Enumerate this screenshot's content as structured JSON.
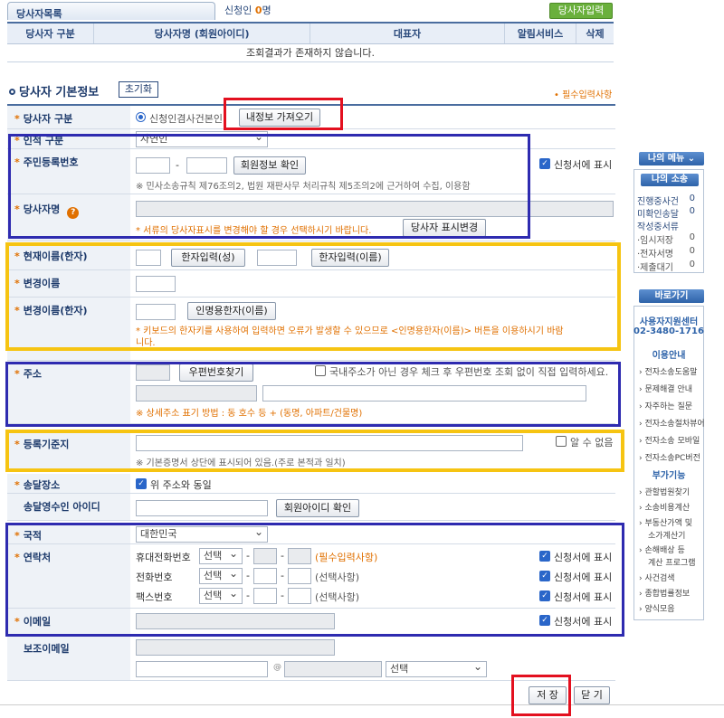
{
  "list": {
    "tab": "당사자목록",
    "count_label": "신청인",
    "count_value": "0",
    "count_unit": "명",
    "input_button": "당사자입력",
    "columns": [
      "당사자 구분",
      "당사자명 (회원아이디)",
      "대표자",
      "알림서비스",
      "삭제"
    ],
    "empty_text": "조회결과가 존재하지 않습니다."
  },
  "section": {
    "title": "당사자 기본정보",
    "reset": "초기화",
    "required_note": "• 필수입력사항"
  },
  "form": {
    "party_type": {
      "label": "당사자 구분",
      "option": "신청인겸사건본인",
      "button": "내정보 가져오기"
    },
    "person_type": {
      "label": "인적 구분",
      "value": "자연인"
    },
    "rrn": {
      "label": "주민등록번호",
      "button": "회원정보 확인",
      "note": "※ 민사소송규칙 제76조의2, 법원 재판사무 처리규칙 제5조의2에 근거하여 수집, 이용함",
      "checkbox": "신청서에 표시"
    },
    "name": {
      "label": "당사자명",
      "warning": "* 서류의 당사자표시를 변경해야 할 경우 선택하시기 바랍니다.",
      "button": "당사자 표시변경"
    },
    "hanja_current": {
      "label": "현재이름(한자)",
      "btn_surname": "한자입력(성)",
      "btn_given": "한자입력(이름)"
    },
    "changed_name": {
      "label": "변경이름"
    },
    "changed_hanja": {
      "label": "변경이름(한자)",
      "button": "인명용한자(이름)",
      "warning_1": "* 키보드의 한자키를 사용하여 입력하면 오류가 발생할 수 있으므로 <인명용한자(이름)> 버튼을 이용하시기 바람",
      "warning_2": "니다."
    },
    "address": {
      "label": "주소",
      "button": "우편번호찾기",
      "checkbox": "국내주소가 아닌 경우 체크 후 우편번호 조회 없이 직접 입력하세요.",
      "note": "※ 상세주소 표기 방법 : 동 호수 등 + (동명, 아파트/건물명)"
    },
    "reg_base": {
      "label": "등록기준지",
      "checkbox": "알 수 없음",
      "note": "※ 기본증명서 상단에 표시되어 있음.(주로 본적과 일치)"
    },
    "delivery": {
      "label": "송달장소",
      "checkbox": "위 주소와 동일"
    },
    "recipient_id": {
      "label": "송달영수인 아이디",
      "button": "회원아이디 확인"
    },
    "nationality": {
      "label": "국적",
      "value": "대한민국"
    },
    "contact": {
      "label": "연락처",
      "rows": [
        {
          "name": "휴대전화번호",
          "select": "선택",
          "hint": "(필수입력사항)",
          "checkbox": "신청서에 표시"
        },
        {
          "name": "전화번호",
          "select": "선택",
          "hint": "(선택사항)",
          "checkbox": "신청서에 표시"
        },
        {
          "name": "팩스번호",
          "select": "선택",
          "hint": "(선택사항)",
          "checkbox": "신청서에 표시"
        }
      ]
    },
    "email": {
      "label": "이메일",
      "checkbox": "신청서에 표시"
    },
    "sub_email": {
      "label": "보조이메일",
      "at": "@",
      "select": "선택"
    }
  },
  "actions": {
    "save": "저 장",
    "close": "닫 기"
  },
  "sidebar": {
    "my_menu": "나의 메뉴",
    "my_case": "나의 소송",
    "stats": [
      {
        "label": "진행중사건",
        "value": "0"
      },
      {
        "label": "미확인송달",
        "value": "0"
      },
      {
        "label": "작성중서류",
        "value": ""
      },
      {
        "label": "·임시저장",
        "value": "0"
      },
      {
        "label": "·전자서명",
        "value": "0"
      },
      {
        "label": "·제출대기",
        "value": "0"
      }
    ],
    "shortcut": "바로가기",
    "support_center": "사용자지원센터",
    "phone": "02-3480-1716",
    "usage_title": "이용안내",
    "usage_links": [
      "전자소송도움말",
      "문제해결 안내",
      "자주하는 질문",
      "전자소송절차뷰어",
      "전자소송 모바일",
      "전자소송PC버전"
    ],
    "extra_title": "부가기능",
    "extra_links": [
      "관할법원찾기",
      "소송비용계산",
      "부동산가액 및",
      "소가계산기",
      "손해배상 등",
      "계산 프로그램",
      "사건검색",
      "종합법률정보",
      "양식모음"
    ]
  }
}
